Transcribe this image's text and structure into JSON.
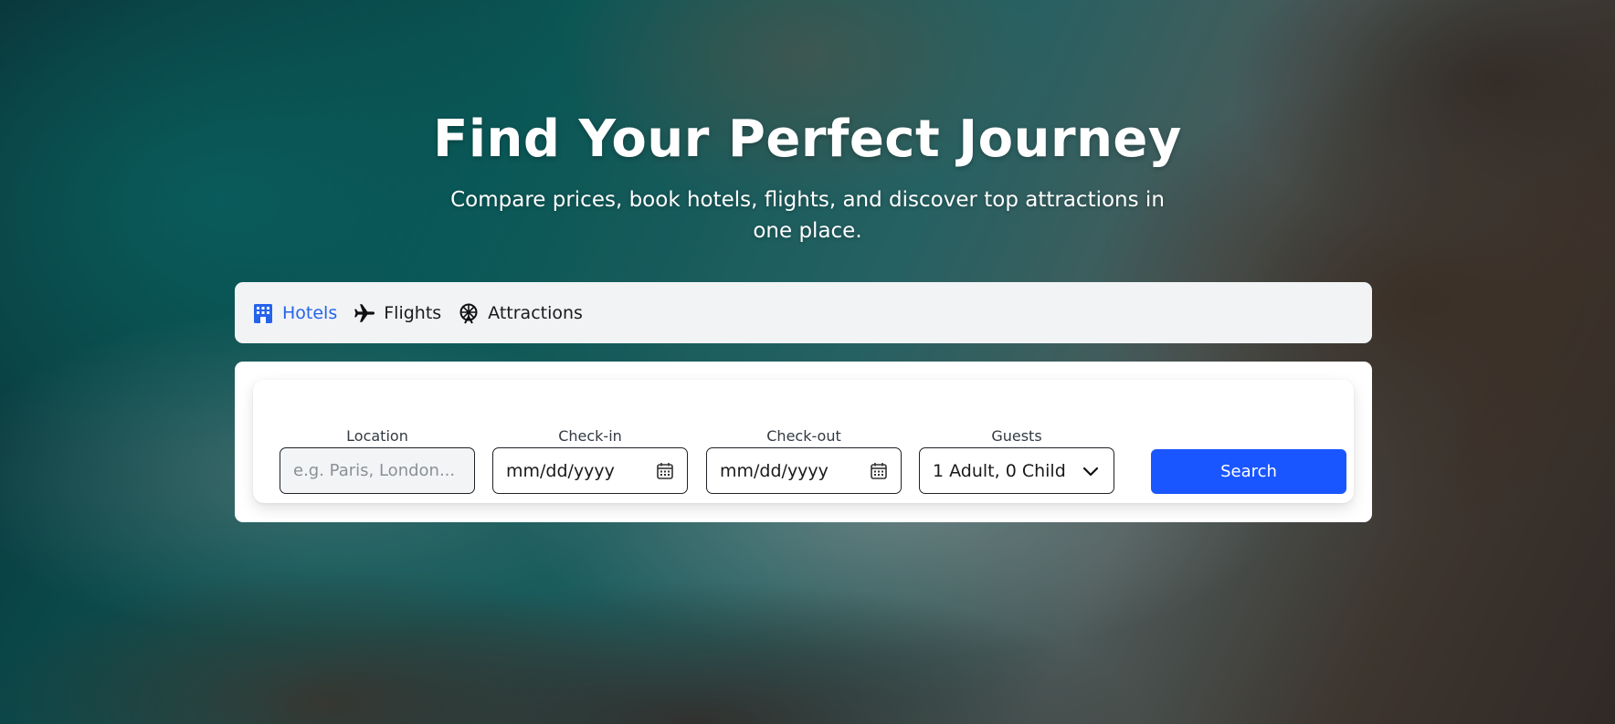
{
  "hero": {
    "title": "Find Your Perfect Journey",
    "subtitle": "Compare prices, book hotels, flights, and discover top attractions in one place."
  },
  "tabs": [
    {
      "label": "Hotels",
      "icon": "hotel-icon",
      "active": true
    },
    {
      "label": "Flights",
      "icon": "airplane-icon",
      "active": false
    },
    {
      "label": "Attractions",
      "icon": "ferris-wheel-icon",
      "active": false
    }
  ],
  "search": {
    "location": {
      "label": "Location",
      "placeholder": "e.g. Paris, London..."
    },
    "checkin": {
      "label": "Check-in",
      "value": "mm/dd/yyyy",
      "icon": "calendar-icon"
    },
    "checkout": {
      "label": "Check-out",
      "value": "mm/dd/yyyy",
      "icon": "calendar-icon"
    },
    "guests": {
      "label": "Guests",
      "value": "1 Adult, 0 Child",
      "icon": "chevron-down-icon"
    },
    "button_label": "Search"
  },
  "colors": {
    "accent": "#1a56ff",
    "active_tab": "#2563eb",
    "tab_bar_bg": "#f1f3f5"
  }
}
